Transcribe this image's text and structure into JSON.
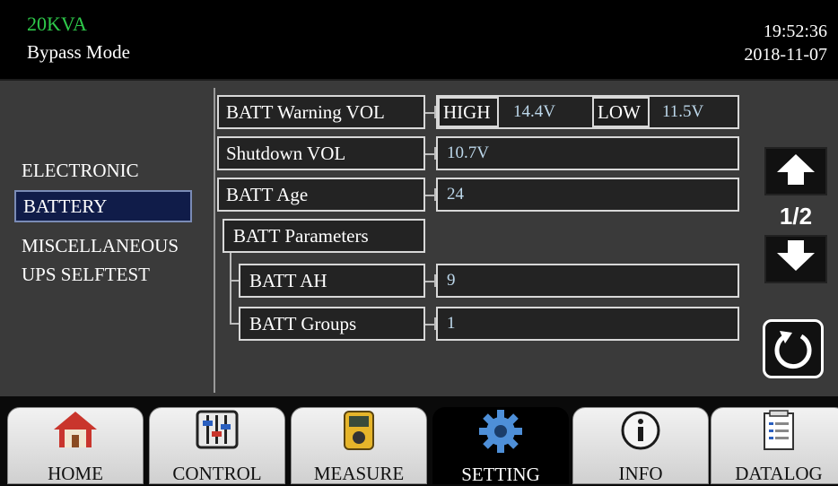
{
  "header": {
    "model": "20KVA",
    "mode": "Bypass Mode",
    "time": "19:52:36",
    "date": "2018-11-07",
    "model_color": "#2ec94a"
  },
  "sidebar": {
    "items": [
      {
        "label": "ELECTRONIC",
        "selected": false
      },
      {
        "label": "BATTERY",
        "selected": true
      },
      {
        "label": "MISCELLANEOUS",
        "selected": false
      },
      {
        "label": "UPS SELFTEST",
        "selected": false
      }
    ]
  },
  "settings": {
    "warning_vol": {
      "label": "BATT Warning VOL",
      "high_label": "HIGH",
      "high_value": "14.4V",
      "low_label": "LOW",
      "low_value": "11.5V"
    },
    "shutdown_vol": {
      "label": "Shutdown VOL",
      "value": "10.7V"
    },
    "age": {
      "label": "BATT Age",
      "value": "24"
    },
    "parameters": {
      "label": "BATT Parameters"
    },
    "ah": {
      "label": "BATT AH",
      "value": "9"
    },
    "groups": {
      "label": "BATT Groups",
      "value": "1"
    }
  },
  "pager": {
    "page": "1/2",
    "icons": [
      "arrow-up-icon",
      "arrow-down-icon",
      "refresh-icon"
    ]
  },
  "tabs": [
    {
      "label": "HOME",
      "icon": "home-icon",
      "active": false
    },
    {
      "label": "CONTROL",
      "icon": "sliders-icon",
      "active": false
    },
    {
      "label": "MEASURE",
      "icon": "multimeter-icon",
      "active": false
    },
    {
      "label": "SETTING",
      "icon": "gear-icon",
      "active": true
    },
    {
      "label": "INFO",
      "icon": "info-icon",
      "active": false
    },
    {
      "label": "DATALOG",
      "icon": "clipboard-icon",
      "active": false
    }
  ]
}
